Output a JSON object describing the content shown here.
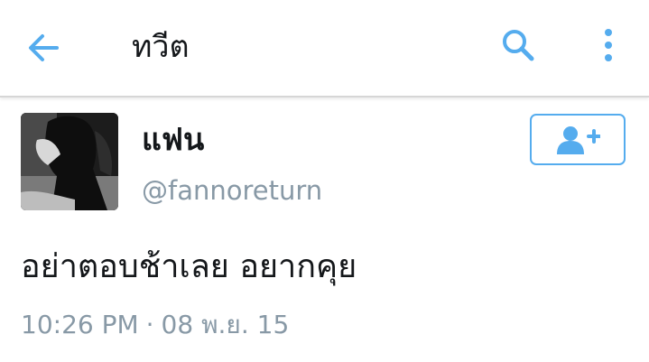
{
  "toolbar": {
    "title": "ทวีต",
    "back_icon": "arrow-left-icon",
    "search_icon": "search-icon",
    "overflow_icon": "more-vertical-icon"
  },
  "tweet": {
    "display_name": "แฟน",
    "handle": "@fannoreturn",
    "text": "อย่าตอบช้าเลย อยากคุย",
    "time": "10:26 PM",
    "separator": "·",
    "date": "08 พ.ย. 15",
    "follow_icon": "add-user-icon"
  },
  "colors": {
    "accent": "#55acee",
    "text_primary": "#14171a",
    "text_secondary": "#8899a6",
    "divider": "#d6d6d6",
    "background": "#ffffff"
  }
}
